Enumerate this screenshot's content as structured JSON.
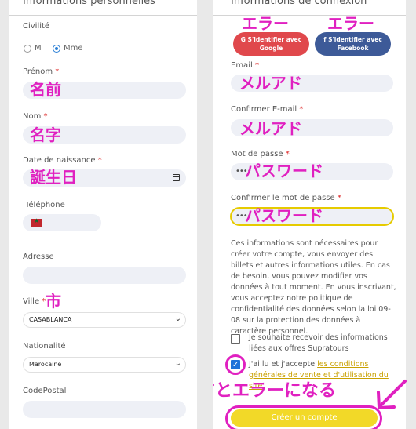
{
  "left": {
    "title": "Informations personnelles",
    "civilite_label": "Civilité",
    "civilite_options": [
      {
        "label": "M",
        "selected": false
      },
      {
        "label": "Mme",
        "selected": true
      }
    ],
    "prenom_label": "Prénom",
    "prenom_note": "名前",
    "nom_label": "Nom",
    "nom_note": "名字",
    "dob_label": "Date de naissance",
    "dob_note": "誕生日",
    "tel_label": "Téléphone",
    "adresse_label": "Adresse",
    "ville_label": "Ville",
    "ville_note": "市",
    "ville_value": "CASABLANCA",
    "nationalite_label": "Nationalité",
    "nationalite_value": "Marocaine",
    "codepostal_label": "CodePostal",
    "required_mark": "*"
  },
  "right": {
    "title": "Informations de connexion",
    "error_note_1": "エラー",
    "error_note_2": "エラー",
    "google_button": "S'identifier avec Google",
    "facebook_button": "S'identifier avec Facebook",
    "google_icon": "G",
    "facebook_icon": "f",
    "email_label": "Email",
    "email_note": "メルアド",
    "confirm_email_label": "Confirmer E-mail",
    "confirm_email_note": "メルアド",
    "password_label": "Mot de passe",
    "password_dots": "••••",
    "password_note": "パスワード",
    "confirm_password_label": "Confirmer le mot de passe",
    "confirm_password_dots": "••••",
    "confirm_password_note": "パスワード",
    "info_paragraph": "Ces informations sont nécessaires pour créer votre compte, vous envoyer des billets et autres informations utiles. En cas de besoin, vous pouvez modifier vos données à tout moment. En vous inscrivant, vous acceptez notre politique de confidentialité des données selon la loi 09-08 sur la protection des données à caractère personnel.",
    "newsletter_text": "Je souhaite recevoir des informations liées aux offres Supratours",
    "newsletter_checked": false,
    "terms_prefix": "J'ai lu et j'accepte ",
    "terms_link": "les conditions générales de vente et d'utilisation du site",
    "terms_checked": true,
    "check_glyph": "✓",
    "submit_button": "Créer un compte",
    "error_annotation": "押すとエラーになる",
    "required_mark": "*"
  },
  "colors": {
    "annotation": "#e020c0",
    "google": "#e0484c",
    "facebook": "#3d5a98",
    "submit": "#f2d928",
    "link": "#c9a100"
  }
}
